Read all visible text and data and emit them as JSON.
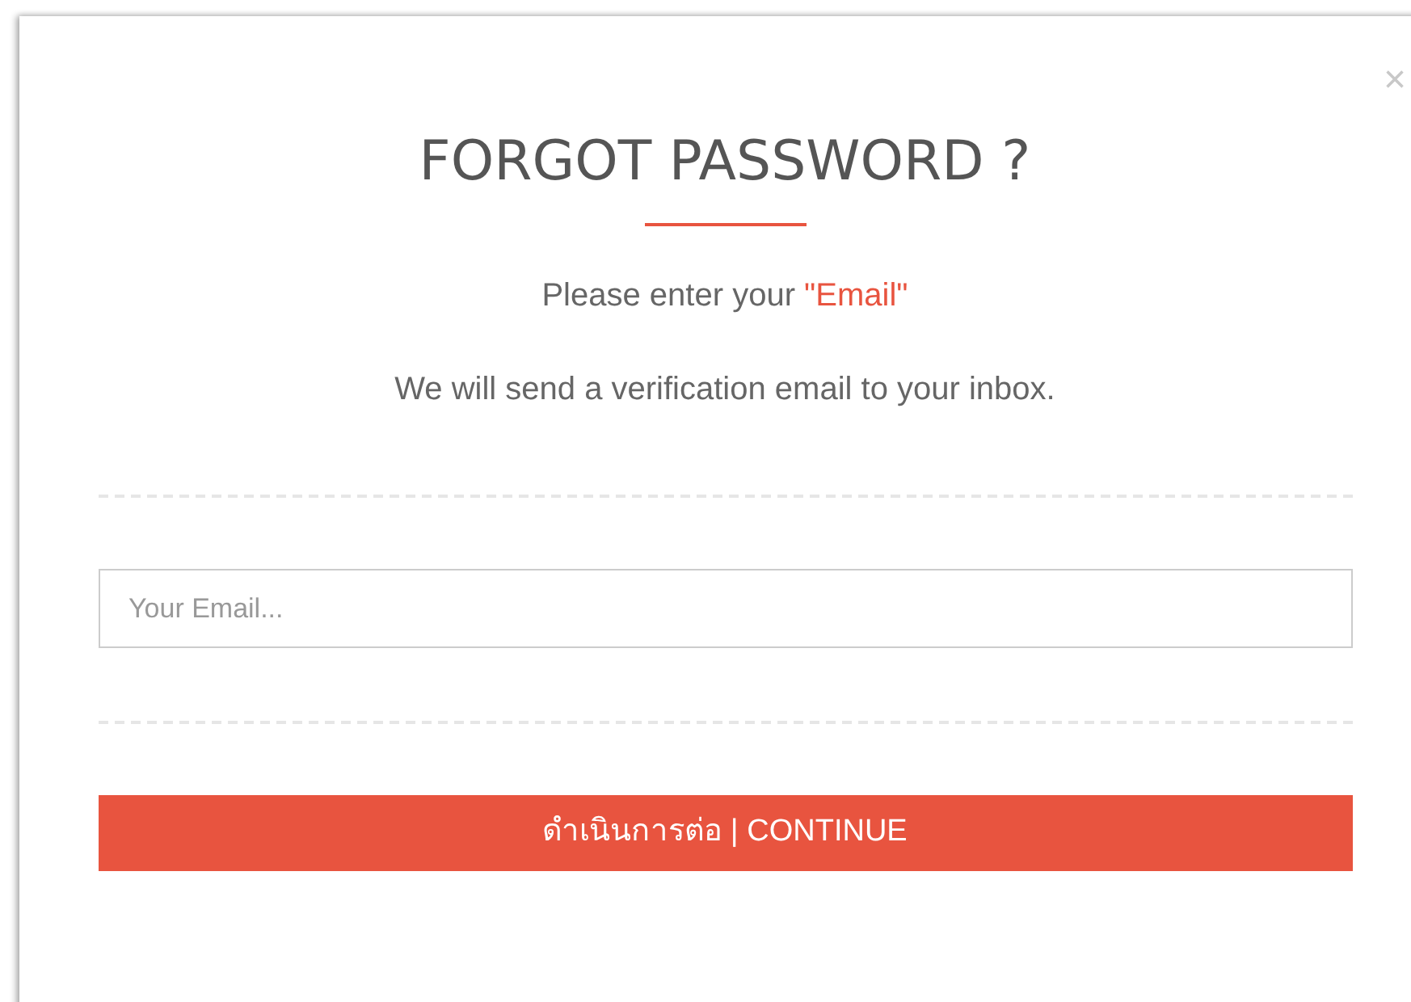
{
  "dialog": {
    "close": "×",
    "title": "FORGOT PASSWORD ?",
    "prompt": {
      "text": "Please enter your",
      "highlight": "\"Email\""
    },
    "note": "We will send a verification email to your inbox.",
    "email": {
      "placeholder": "Your Email..."
    },
    "button": "ดำเนินการต่อ | CONTINUE"
  }
}
